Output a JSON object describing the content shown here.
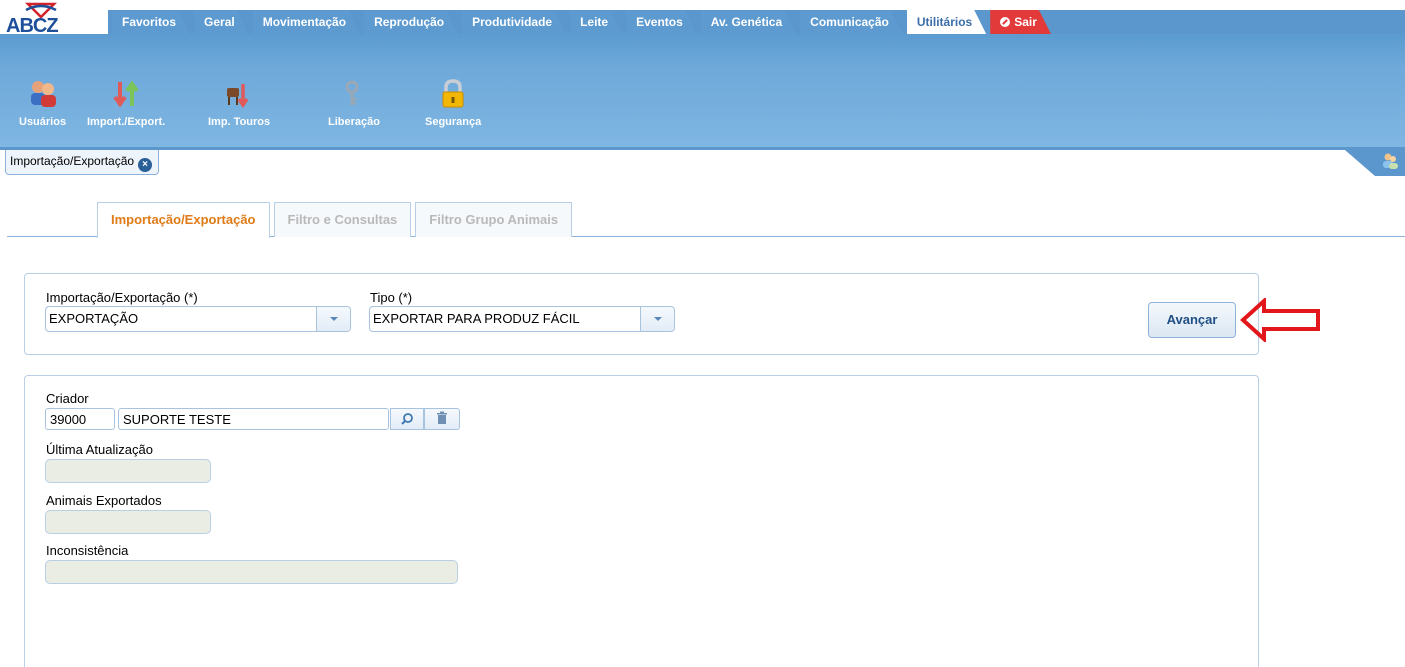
{
  "app": {
    "logo_text": "ABCZ"
  },
  "top_menu": [
    {
      "label": "Favoritos"
    },
    {
      "label": "Geral"
    },
    {
      "label": "Movimentação"
    },
    {
      "label": "Reprodução"
    },
    {
      "label": "Produtividade"
    },
    {
      "label": "Leite"
    },
    {
      "label": "Eventos"
    },
    {
      "label": "Av. Genética"
    },
    {
      "label": "Comunicação"
    },
    {
      "label": "Utilitários",
      "active": true
    },
    {
      "label": "Sair"
    }
  ],
  "toolbar": [
    {
      "label": "Usuários",
      "icon": "users-icon"
    },
    {
      "label": "Import./Export.",
      "icon": "import-export-arrows-icon"
    },
    {
      "label": "Imp. Touros",
      "icon": "bulls-icon"
    },
    {
      "label": "Liberação",
      "icon": "key-icon"
    },
    {
      "label": "Segurança",
      "icon": "padlock-icon"
    }
  ],
  "doc_tab": {
    "label": "Importação/Exportação"
  },
  "content_tabs": [
    {
      "label": "Importação/Exportação",
      "active": true
    },
    {
      "label": "Filtro e Consultas"
    },
    {
      "label": "Filtro Grupo Animais"
    }
  ],
  "form": {
    "impexp_label": "Importação/Exportação (*)",
    "impexp_value": "EXPORTAÇÃO",
    "tipo_label": "Tipo (*)",
    "tipo_value": "EXPORTAR PARA PRODUZ FÁCIL",
    "avancar_label": "Avançar",
    "criador_label": "Criador",
    "criador_code": "39000",
    "criador_name": "SUPORTE TESTE",
    "ultima_label": "Última Atualização",
    "ultima_value": "",
    "animais_label": "Animais Exportados",
    "animais_value": "",
    "inconsistencia_label": "Inconsistência",
    "inconsistencia_value": ""
  },
  "colors": {
    "menu_band": "#6ea9da",
    "active_tab_text": "#e07b17",
    "annotation_arrow": "#e3161b"
  }
}
